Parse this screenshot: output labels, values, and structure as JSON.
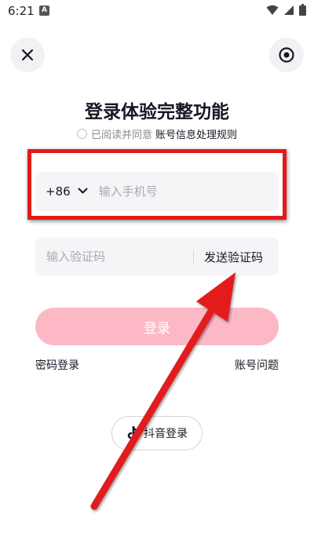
{
  "status_bar": {
    "time": "6:21",
    "notification_glyph": "A",
    "icons": [
      "wifi-icon",
      "signal-icon",
      "battery-icon"
    ]
  },
  "header": {
    "close_icon": "close-icon",
    "settings_icon": "target-icon"
  },
  "title": "登录体验完整功能",
  "agreement": {
    "text": "已阅读并同意",
    "link": "账号信息处理规则"
  },
  "phone": {
    "country_code": "+86",
    "placeholder": "输入手机号"
  },
  "code": {
    "placeholder": "输入验证码",
    "send_label": "发送验证码"
  },
  "login_button": "登录",
  "links": {
    "password_login": "密码登录",
    "account_issue": "账号问题"
  },
  "douyin_login": "抖音登录",
  "colors": {
    "accent": "#fcb9c5",
    "annotation_red": "#e21a1a",
    "field_bg": "#f5f5f7"
  }
}
